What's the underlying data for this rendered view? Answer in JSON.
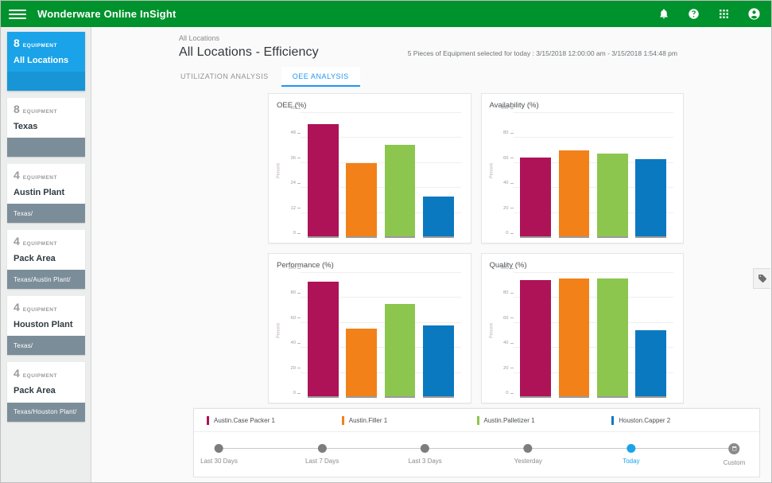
{
  "topbar": {
    "menu_icon": "hamburger-icon",
    "title": "Wonderware Online InSight",
    "icons": [
      "bell-icon",
      "help-icon",
      "apps-grid-icon",
      "account-icon"
    ]
  },
  "sidebar": {
    "items": [
      {
        "count": "8",
        "unit": "EQUIPMENT",
        "name": "All Locations",
        "path": "",
        "selected": true
      },
      {
        "count": "8",
        "unit": "EQUIPMENT",
        "name": "Texas",
        "path": "",
        "selected": false
      },
      {
        "count": "4",
        "unit": "EQUIPMENT",
        "name": "Austin Plant",
        "path": "Texas/",
        "selected": false
      },
      {
        "count": "4",
        "unit": "EQUIPMENT",
        "name": "Pack Area",
        "path": "Texas/Austin Plant/",
        "selected": false
      },
      {
        "count": "4",
        "unit": "EQUIPMENT",
        "name": "Houston Plant",
        "path": "Texas/",
        "selected": false
      },
      {
        "count": "4",
        "unit": "EQUIPMENT",
        "name": "Pack Area",
        "path": "Texas/Houston Plant/",
        "selected": false
      }
    ]
  },
  "header": {
    "breadcrumb": "All Locations",
    "title": "All Locations - Efficiency",
    "selection_info": "5 Pieces of Equipment selected for today : 3/15/2018 12:00:00 am - 3/15/2018 1:54:48 pm",
    "tabs": [
      {
        "label": "UTILIZATION ANALYSIS",
        "active": false
      },
      {
        "label": "OEE ANALYSIS",
        "active": true
      }
    ]
  },
  "colors": {
    "brand_green": "#00922d",
    "accent_blue": "#1aa3e8",
    "tab_active": "#2196f3",
    "series": [
      "#ae1257",
      "#f2811a",
      "#8cc64f",
      "#0b79c0"
    ]
  },
  "legend": [
    {
      "label": "Austin.Case Packer 1",
      "color": "#ae1257"
    },
    {
      "label": "Austin.Filler 1",
      "color": "#f2811a"
    },
    {
      "label": "Austin.Palletizer 1",
      "color": "#8cc64f"
    },
    {
      "label": "Houston.Capper 2",
      "color": "#0b79c0"
    }
  ],
  "timeline": {
    "nodes": [
      {
        "label": "Last 30 Days",
        "active": false,
        "custom": false
      },
      {
        "label": "Last 7 Days",
        "active": false,
        "custom": false
      },
      {
        "label": "Last 3 Days",
        "active": false,
        "custom": false
      },
      {
        "label": "Yesterday",
        "active": false,
        "custom": false
      },
      {
        "label": "Today",
        "active": true,
        "custom": false
      },
      {
        "label": "Custom",
        "active": false,
        "custom": true
      }
    ]
  },
  "tag_panel": {
    "icon": "tag-icon"
  },
  "chart_data": [
    {
      "type": "bar",
      "title": "OEE (%)",
      "xlabel": "",
      "ylabel": "Percent",
      "ylim": [
        0,
        60
      ],
      "yticks": [
        0,
        12,
        24,
        36,
        48,
        60
      ],
      "grid": true,
      "legend_position": "bottom",
      "categories": [
        "Austin.Case Packer 1",
        "Austin.Filler 1",
        "Austin.Palletizer 1",
        "Houston.Capper 2"
      ],
      "values": [
        54,
        35,
        44,
        19
      ],
      "colors": [
        "#ae1257",
        "#f2811a",
        "#8cc64f",
        "#0b79c0"
      ]
    },
    {
      "type": "bar",
      "title": "Availability (%)",
      "xlabel": "",
      "ylabel": "Percent",
      "ylim": [
        0,
        100
      ],
      "yticks": [
        0,
        20,
        40,
        60,
        80,
        100
      ],
      "grid": true,
      "legend_position": "bottom",
      "categories": [
        "Austin.Case Packer 1",
        "Austin.Filler 1",
        "Austin.Palletizer 1",
        "Houston.Capper 2"
      ],
      "values": [
        63,
        69,
        66,
        62
      ],
      "colors": [
        "#ae1257",
        "#f2811a",
        "#8cc64f",
        "#0b79c0"
      ]
    },
    {
      "type": "bar",
      "title": "Performance (%)",
      "xlabel": "",
      "ylabel": "Percent",
      "ylim": [
        0,
        100
      ],
      "yticks": [
        0,
        20,
        40,
        60,
        80,
        100
      ],
      "grid": true,
      "legend_position": "bottom",
      "categories": [
        "Austin.Case Packer 1",
        "Austin.Filler 1",
        "Austin.Palletizer 1",
        "Houston.Capper 2"
      ],
      "values": [
        92,
        54,
        74,
        57
      ],
      "colors": [
        "#ae1257",
        "#f2811a",
        "#8cc64f",
        "#0b79c0"
      ]
    },
    {
      "type": "bar",
      "title": "Quality (%)",
      "xlabel": "",
      "ylabel": "Percent",
      "ylim": [
        0,
        100
      ],
      "yticks": [
        0,
        20,
        40,
        60,
        80,
        100
      ],
      "grid": true,
      "legend_position": "bottom",
      "categories": [
        "Austin.Case Packer 1",
        "Austin.Filler 1",
        "Austin.Palletizer 1",
        "Houston.Capper 2"
      ],
      "values": [
        93,
        94,
        94,
        53
      ],
      "colors": [
        "#ae1257",
        "#f2811a",
        "#8cc64f",
        "#0b79c0"
      ]
    }
  ]
}
